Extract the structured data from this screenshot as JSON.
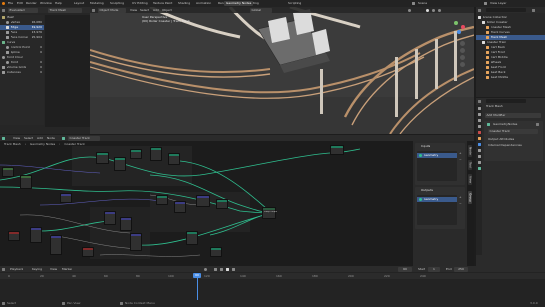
{
  "topbar": {
    "menus": [
      "File",
      "Edit",
      "Render",
      "Window",
      "Help"
    ],
    "workspace_tabs": [
      "Layout",
      "Modeling",
      "Sculpting",
      "UV Editing",
      "Texture Paint",
      "Shading",
      "Animation",
      "Rendering",
      "Compositing",
      "Geometry Nodes",
      "Scripting"
    ],
    "active_tab": "Geometry Nodes",
    "scene_label": "Scene",
    "view_layer_label": "View Layer"
  },
  "spreadsheet": {
    "editor_label": "Evaluated",
    "object_label": "Track Mesh",
    "domains": [
      {
        "label": "Mesh"
      },
      {
        "label": "Vertex",
        "count": "26,080"
      },
      {
        "label": "Edge",
        "count": "49,920"
      },
      {
        "label": "Face",
        "count": "23,976"
      },
      {
        "label": "Face Corner",
        "count": "95,904"
      },
      {
        "label": "Curve"
      },
      {
        "label": "Control Point",
        "count": "0"
      },
      {
        "label": "Spline",
        "count": "0"
      },
      {
        "label": "Point Cloud"
      },
      {
        "label": "Point",
        "count": "0"
      },
      {
        "label": "Volume Grids",
        "count": "0"
      },
      {
        "label": "Instances",
        "count": "0"
      }
    ],
    "selected_index": 2,
    "footer": "Rows: 0  |  Columns: 0"
  },
  "viewport": {
    "view_mode": "Object Mode",
    "menus": [
      "View",
      "Select",
      "Add",
      "Object"
    ],
    "orientation": "Global",
    "overlay_title": "User Perspective",
    "overlay_subtitle": "(60) Roller Coaster | Track Mesh"
  },
  "node_editor": {
    "menus": [
      "View",
      "Select",
      "Add",
      "Node"
    ],
    "tree_name": "Coaster Track",
    "breadcrumb": [
      "Track Mesh",
      "Geometry Nodes",
      "Coaster Track"
    ],
    "output_node_label": "Group Output"
  },
  "node_sidebar": {
    "inputs_title": "Inputs",
    "outputs_title": "Outputs",
    "inputs": [
      "Geometry"
    ],
    "outputs": [
      "Geometry"
    ],
    "tabs": [
      "Node",
      "Tool",
      "View",
      "Group"
    ]
  },
  "outliner": {
    "title": "Scene Collection",
    "items": [
      {
        "label": "Scene Collection",
        "level": 0
      },
      {
        "label": "Roller Coaster",
        "level": 1
      },
      {
        "label": "Coaster Mesh",
        "level": 2
      },
      {
        "label": "Track Curves",
        "level": 2
      },
      {
        "label": "Track Mesh",
        "level": 2
      },
      {
        "label": "Coaster Train",
        "level": 1
      },
      {
        "label": "Cart Back",
        "level": 2
      },
      {
        "label": "Cart Front",
        "level": 2
      },
      {
        "label": "Cart Middle",
        "level": 2
      },
      {
        "label": "Wheels",
        "level": 2
      },
      {
        "label": "Seat Front",
        "level": 2
      },
      {
        "label": "Seat Back",
        "level": 2
      },
      {
        "label": "Seat Middle",
        "level": 2
      }
    ],
    "selected_index": 4
  },
  "properties": {
    "object_name": "Track Mesh",
    "modifier_panel_label": "Add Modifier",
    "modifier_name": "GeometryNodes",
    "node_group": "Coaster Track",
    "sections": [
      "Output Attributes",
      "Internal Dependencies"
    ]
  },
  "timeline": {
    "menus": [
      "Playback",
      "Keying",
      "View",
      "Marker"
    ],
    "current_frame": "60",
    "start_label": "Start",
    "start_frame": "1",
    "end_label": "End",
    "end_frame": "250",
    "ruler": [
      "0",
      "20",
      "40",
      "60",
      "80",
      "100",
      "120",
      "140",
      "160",
      "180",
      "200",
      "220",
      "240"
    ]
  },
  "statusbar": {
    "left": "Select",
    "middle": "Pan View",
    "right": "Node Context Menu",
    "version": "3.0.0"
  },
  "colors": {
    "accent": "#3a5a8c",
    "geometry_wire": "#2fbf8f",
    "playhead": "#4a8ee6",
    "rail": "#b9906a"
  }
}
